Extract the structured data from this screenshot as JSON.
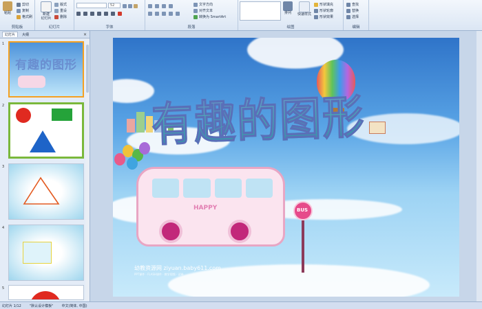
{
  "ribbon": {
    "clipboard": {
      "label": "剪贴板",
      "paste": "粘贴",
      "cut": "剪切",
      "copy": "复制",
      "format_painter": "格式刷"
    },
    "slides": {
      "label": "幻灯片",
      "new_slide": "新建",
      "new_slide_2": "幻灯片",
      "layout": "版式",
      "reset": "重设",
      "delete": "删除"
    },
    "font": {
      "label": "字体",
      "font_size": "52"
    },
    "paragraph": {
      "label": "段落",
      "text_direction": "文字方向",
      "align_text": "对齐文本",
      "smartart": "转换为 SmartArt"
    },
    "drawing": {
      "label": "绘图",
      "arrange": "排列",
      "quick_styles": "快速样式",
      "fill": "形状填充",
      "outline": "形状轮廓",
      "effects": "形状效果"
    },
    "editing": {
      "label": "编辑",
      "find": "查找",
      "replace": "替换",
      "select": "选择"
    }
  },
  "panel": {
    "tab_slides": "幻灯片",
    "tab_outline": "大纲",
    "close": "×",
    "thumbs": [
      {
        "num": "1"
      },
      {
        "num": "2"
      },
      {
        "num": "3"
      },
      {
        "num": "4"
      },
      {
        "num": "5"
      }
    ]
  },
  "slide": {
    "title": "有趣的图形",
    "bus_text": "HAPPY",
    "sign_text": "BUS",
    "watermark": "幼教资源网 ziyuan.baby611.com",
    "watermark_sub": "PPT课件 · FLASH课件 · 教学视频 · 试卷"
  },
  "status": {
    "slide_info": "幻灯片 1/12",
    "theme": "\"默认设计模板\"",
    "language": "中文(简体, 中国)"
  },
  "colors": {
    "selection": "#f5a020",
    "ribbon_border": "#9db3cf",
    "title_fill": "#49a9b5"
  }
}
